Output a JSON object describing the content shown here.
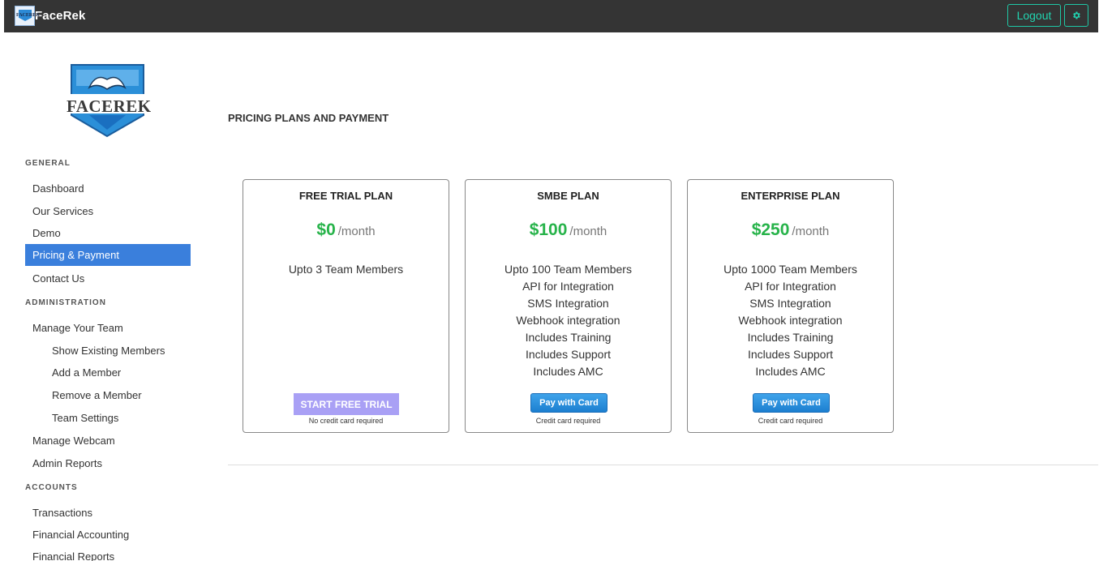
{
  "app": {
    "brand_name": "FaceRek",
    "brand_icon_text": "FACEREK",
    "logo_text": "FACEREK",
    "logout_label": "Logout",
    "accent_color": "#1fc8a6"
  },
  "sidebar": {
    "sections": [
      {
        "heading": "GENERAL",
        "items": [
          {
            "label": "Dashboard"
          },
          {
            "label": "Our Services"
          },
          {
            "label": "Demo"
          },
          {
            "label": "Pricing & Payment",
            "active": true
          },
          {
            "label": "Contact Us"
          }
        ]
      },
      {
        "heading": "ADMINISTRATION",
        "items": [
          {
            "label": "Manage Your Team"
          },
          {
            "label": "Show Existing Members"
          },
          {
            "label": "Add a Member"
          },
          {
            "label": "Remove a Member"
          },
          {
            "label": "Team Settings"
          },
          {
            "label": "Manage Webcam"
          },
          {
            "label": "Admin Reports"
          }
        ]
      },
      {
        "heading": "ACCOUNTS",
        "items": [
          {
            "label": "Transactions"
          },
          {
            "label": "Financial Accounting"
          },
          {
            "label": "Financial Reports"
          }
        ]
      }
    ]
  },
  "main": {
    "page_title": "PRICING PLANS AND PAYMENT",
    "plans": [
      {
        "title": "FREE TRIAL PLAN",
        "price": "$0",
        "period": "/month",
        "features": [
          "Upto 3 Team Members"
        ],
        "button_label": "START FREE TRIAL",
        "note": "No credit card required"
      },
      {
        "title": "SMBE PLAN",
        "price": "$100",
        "period": "/month",
        "features": [
          "Upto 100 Team Members",
          "API for Integration",
          "SMS Integration",
          "Webhook integration",
          "Includes Training",
          "Includes Support",
          "Includes AMC"
        ],
        "button_label": "Pay with Card",
        "note": "Credit card required"
      },
      {
        "title": "ENTERPRISE PLAN",
        "price": "$250",
        "period": "/month",
        "features": [
          "Upto 1000 Team Members",
          "API for Integration",
          "SMS Integration",
          "Webhook integration",
          "Includes Training",
          "Includes Support",
          "Includes AMC"
        ],
        "button_label": "Pay with Card",
        "note": "Credit card required"
      }
    ]
  }
}
